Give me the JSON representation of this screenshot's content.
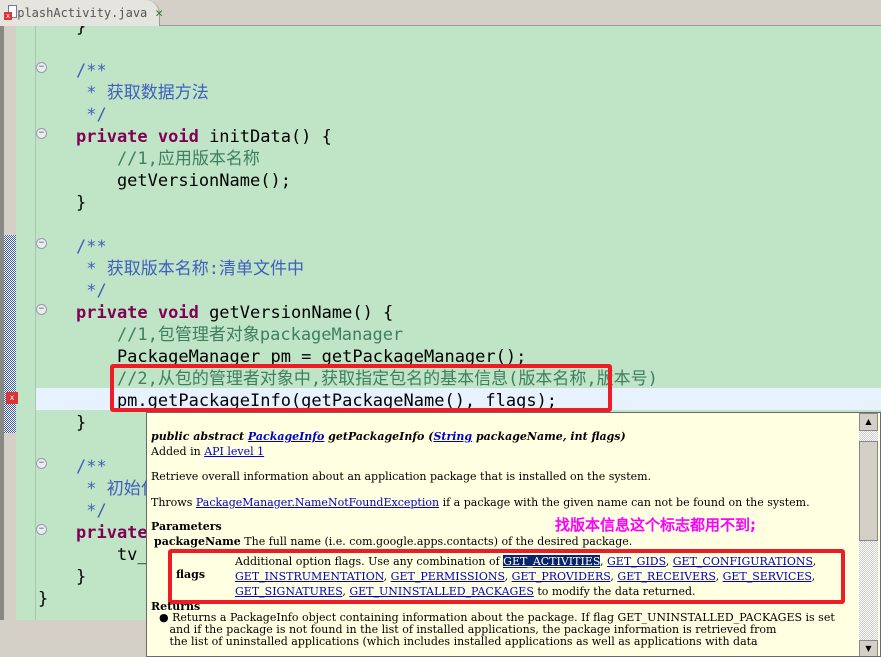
{
  "tab": {
    "title": "SplashActivity.java",
    "close_icon": "close-icon"
  },
  "code": [
    {
      "t": "}"
    },
    {
      "t": ""
    },
    {
      "t": "/**",
      "c": "cm"
    },
    {
      "t": " * 获取数据方法",
      "c": "cm"
    },
    {
      "t": " */",
      "c": "cm"
    },
    {
      "kw": "private void",
      "t": " initData() {"
    },
    {
      "t": "    //1,应用版本名称",
      "c": "lc"
    },
    {
      "t": "    getVersionName();"
    },
    {
      "t": "}"
    },
    {
      "t": ""
    },
    {
      "t": "/**",
      "c": "cm"
    },
    {
      "t": " * 获取版本名称:清单文件中",
      "c": "cm"
    },
    {
      "t": " */",
      "c": "cm"
    },
    {
      "kw": "private void",
      "t": " getVersionName() {"
    },
    {
      "t": "    //1,包管理者对象packageManager",
      "c": "lc"
    },
    {
      "t": "    PackageManager pm = getPackageManager();"
    },
    {
      "t": "    //2,从包的管理者对象中,获取指定包名的基本信息(版本名称,版本号)",
      "c": "lc"
    },
    {
      "t": "    pm.getPackageInfo(getPackageName(), flags);"
    },
    {
      "t": "}"
    },
    {
      "t": ""
    },
    {
      "t": "/**",
      "c": "cm"
    },
    {
      "t": " * 初始化",
      "c": "cm"
    },
    {
      "t": " */",
      "c": "cm"
    },
    {
      "kw": "private",
      "t": ""
    },
    {
      "t": "    tv_"
    },
    {
      "t": "}"
    },
    {
      "t": "}"
    }
  ],
  "doc": {
    "sig_prefix": "public abstract ",
    "sig_type": "PackageInfo",
    "sig_method": " getPackageInfo (",
    "sig_string": "String",
    "sig_rest": " packageName, int flags)",
    "added": "Added in ",
    "api_level": "API level 1",
    "desc": "Retrieve overall information about an application package that is installed on the system.",
    "throws": "Throws ",
    "exception": "PackageManager.NameNotFoundException",
    "throws_rest": " if a package with the given name can not be found on the system.",
    "params_heading": "Parameters",
    "param1_name": "packageName",
    "param1_desc": "The full name (i.e. com.google.apps.contacts) of the desired package.",
    "param2_name": "flags",
    "param2_desc": "Additional option flags. Use any combination of",
    "flags": [
      "GET_ACTIVITIES",
      "GET_GIDS",
      "GET_CONFIGURATIONS",
      "GET_INSTRUMENTATION",
      "GET_PERMISSIONS",
      "GET_PROVIDERS",
      "GET_RECEIVERS",
      "GET_SERVICES",
      "GET_SIGNATURES",
      "GET_UNINSTALLED_PACKAGES"
    ],
    "param2_tail": " to modify the data returned.",
    "returns_heading": "Returns",
    "returns_1": "Returns a PackageInfo object containing information about the package. If flag GET_UNINSTALLED_PACKAGES is set",
    "returns_2": "and if the package is not found in the list of installed applications, the package information is retrieved from",
    "returns_3": "the list of uninstalled applications (which includes installed applications as well as applications with data"
  },
  "annotation": "找版本信息这个标志都用不到;",
  "colors": {
    "editor_bg": "#c0e4c6",
    "keyword": "#7f0055",
    "javadoc": "#3f5fbf",
    "comment": "#3f7f5f",
    "highlight": "#ee1c24",
    "annotation": "#ff00ff"
  }
}
